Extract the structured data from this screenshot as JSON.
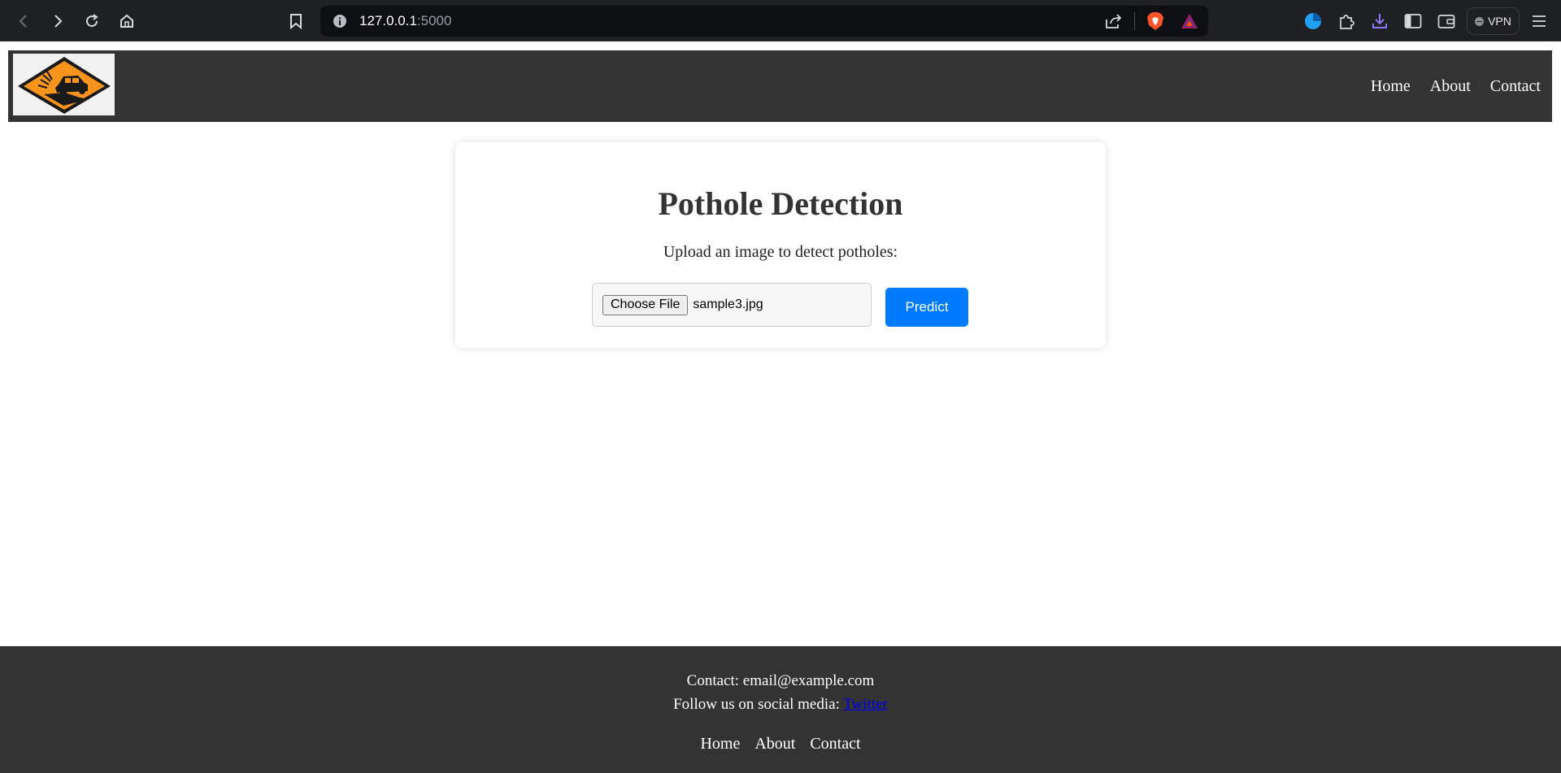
{
  "browser": {
    "url_host": "127.0.0.1",
    "url_port": ":5000",
    "vpn_label": "VPN"
  },
  "header": {
    "nav": [
      "Home",
      "About",
      "Contact"
    ]
  },
  "main": {
    "title": "Pothole Detection",
    "subtitle": "Upload an image to detect potholes:",
    "choose_file_label": "Choose File",
    "file_name": "sample3.jpg",
    "predict_label": "Predict"
  },
  "footer": {
    "contact_text": "Contact: email@example.com",
    "follow_text": "Follow us on social media:",
    "twitter_label": "Twitter",
    "nav": [
      "Home",
      "About",
      "Contact"
    ]
  },
  "colors": {
    "header_bg": "#333333",
    "predict_button": "#007bff",
    "logo_orange": "#f7941d"
  }
}
